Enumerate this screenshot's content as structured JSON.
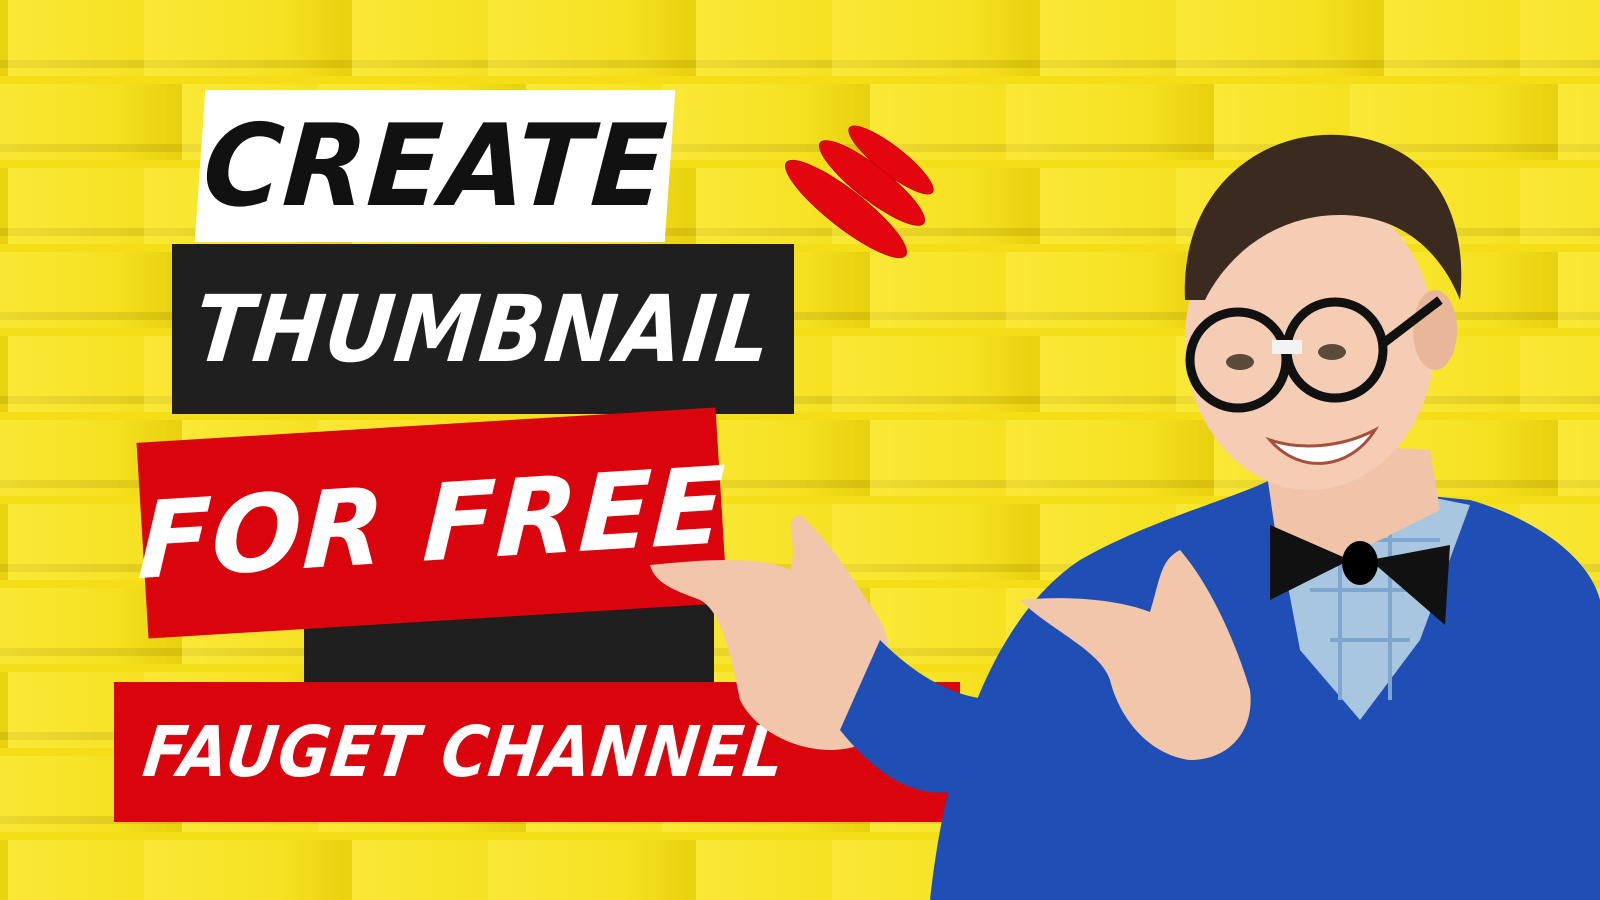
{
  "thumbnail": {
    "line1": "CREATE",
    "line2": "THUMBNAIL",
    "line3": "FOR FREE",
    "channel": "FAUGET CHANNEL"
  },
  "colors": {
    "background": "#f3de18",
    "accent_red": "#d9040c",
    "dark": "#1f1f1f",
    "white": "#ffffff",
    "sweater_blue": "#1f4fb5"
  }
}
